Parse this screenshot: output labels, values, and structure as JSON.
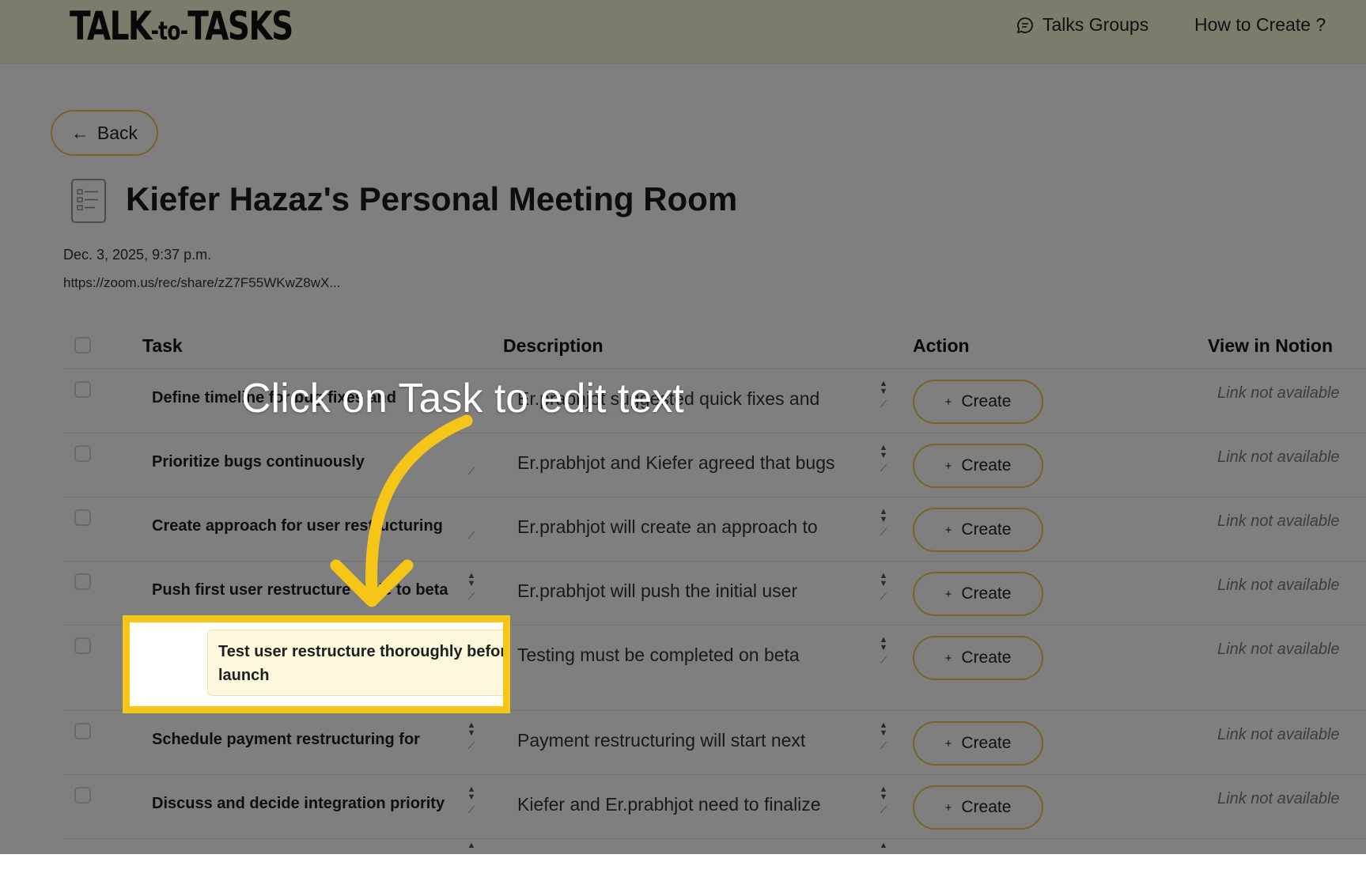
{
  "header": {
    "logo": {
      "left": "TALK",
      "mid": "-to-",
      "right": "TASKS"
    },
    "nav": [
      {
        "label": "Talks Groups",
        "icon": "chat-bubble-icon"
      },
      {
        "label": "How to Create ?"
      }
    ]
  },
  "back_label": "Back",
  "page": {
    "title": "Kiefer Hazaz's Personal Meeting Room",
    "icon": "task-list-icon",
    "date": "Dec. 3, 2025, 9:37 p.m.",
    "recording_link": "https://zoom.us/rec/share/zZ7F55WKwZ8wX..."
  },
  "table": {
    "headers": {
      "task": "Task",
      "description": "Description",
      "action": "Action",
      "notion": "View in Notion"
    },
    "create_label": "Create",
    "notion_na": "Link not available",
    "rows": [
      {
        "task": "Define timeline for bug fixes and",
        "description": "Er.prabhjot suggested quick fixes and"
      },
      {
        "task": "Prioritize bugs continuously",
        "description": "Er.prabhjot and Kiefer agreed that bugs"
      },
      {
        "task": "Create approach for user restructuring",
        "description": "Er.prabhjot will create an approach to"
      },
      {
        "task": "Push first user restructure code to beta",
        "description": "Er.prabhjot will push the initial user"
      },
      {
        "task": "Test user restructure thoroughly before launch",
        "description": "Testing must be completed on beta"
      },
      {
        "task": "Schedule payment restructuring for",
        "description": "Payment restructuring will start next"
      },
      {
        "task": "Discuss and decide integration priority",
        "description": "Kiefer and Er.prabhjot need to finalize"
      }
    ]
  },
  "overlay": {
    "callout": "Click on Task to edit text",
    "highlight_color": "#f5c518"
  }
}
